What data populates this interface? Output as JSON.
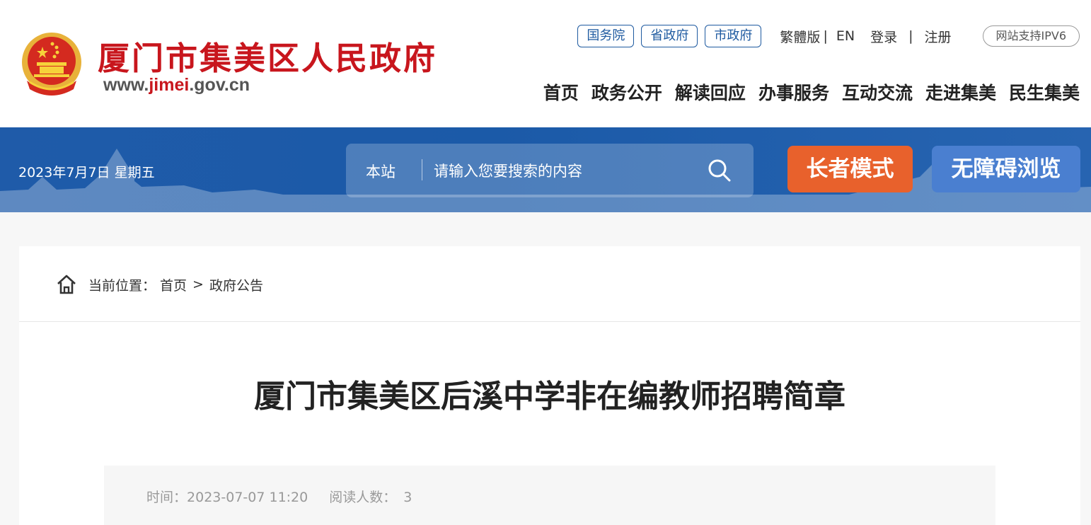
{
  "header": {
    "site_title": "厦门市集美区人民政府",
    "url_prefix": "www.",
    "url_highlight": "jimei",
    "url_suffix": ".gov.cn",
    "emblem_icon": "national-emblem-icon",
    "gov_links": [
      "国务院",
      "省政府",
      "市政府"
    ],
    "traditional": "繁體版",
    "sep": "|",
    "english": "EN",
    "login": "登录",
    "register": "注册",
    "ipv6": "网站支持IPV6",
    "nav": [
      "首页",
      "政务公开",
      "解读回应",
      "办事服务",
      "互动交流",
      "走进集美",
      "民生集美"
    ]
  },
  "banner": {
    "date": "2023年7月7日 星期五",
    "search_scope": "本站",
    "search_placeholder": "请输入您要搜索的内容",
    "elder_mode": "长者模式",
    "accessible": "无障碍浏览"
  },
  "breadcrumb": {
    "label": "当前位置：",
    "home": "首页",
    "sep": ">",
    "current": "政府公告"
  },
  "article": {
    "title": "厦门市集美区后溪中学非在编教师招聘简章",
    "time_label": "时间：",
    "time_value": "2023-07-07 11:20",
    "reads_label": "阅读人数：",
    "reads_value": "3"
  },
  "colors": {
    "brand_red": "#c8161d",
    "banner_blue": "#1f5ba9",
    "elder_orange": "#e8612c",
    "access_blue": "#4a7fd0"
  }
}
